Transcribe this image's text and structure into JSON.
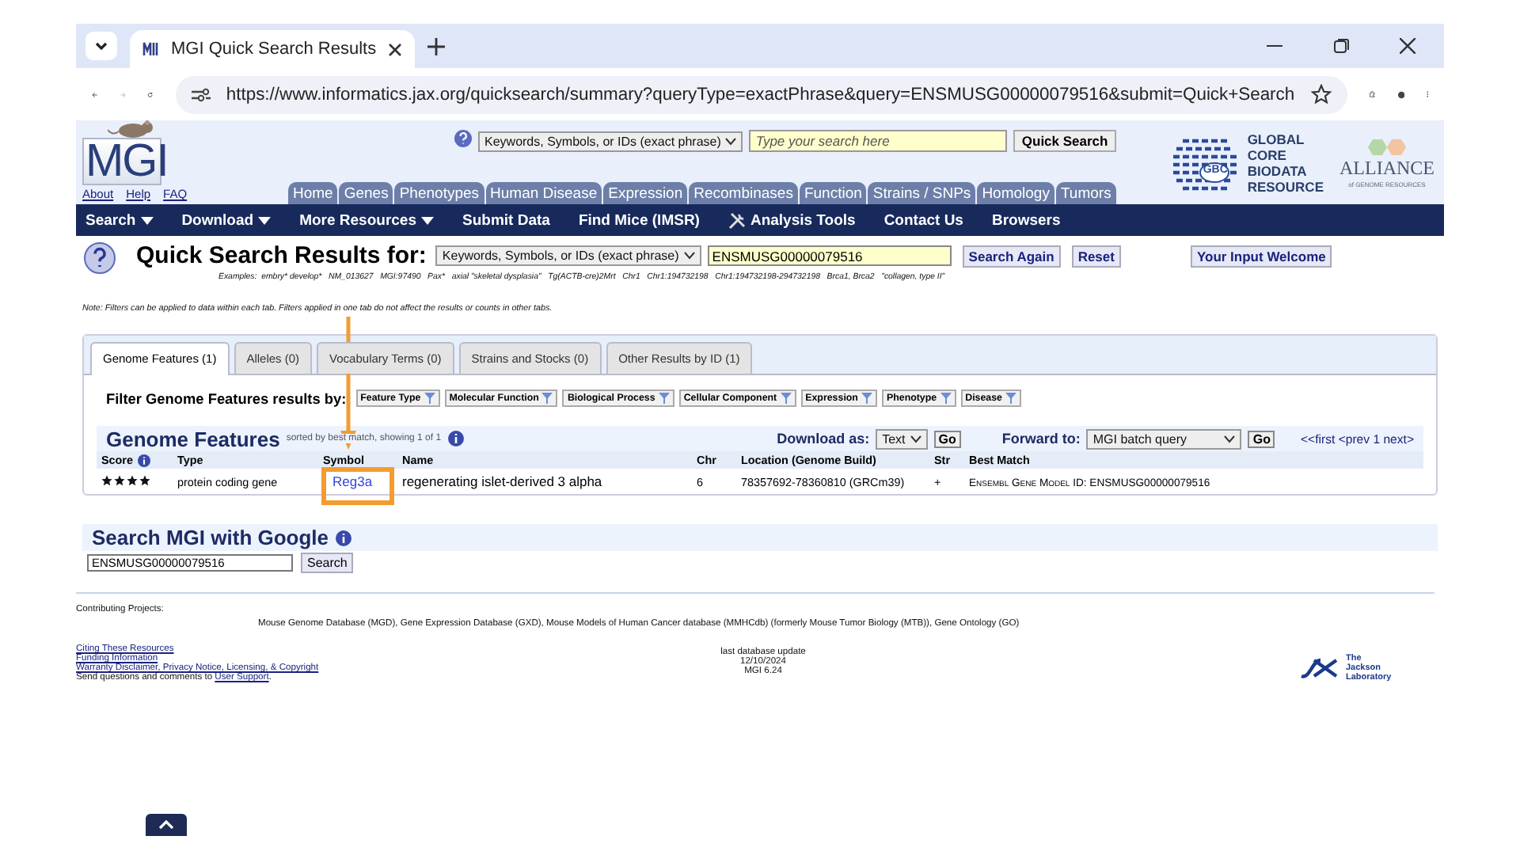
{
  "browser": {
    "tab_title": "MGI Quick Search Results",
    "url": "https://www.informatics.jax.org/quicksearch/summary?queryType=exactPhrase&query=ENSMUSG00000079516&submit=Quick+Search"
  },
  "header": {
    "search_type": "Keywords, Symbols, or IDs (exact phrase)",
    "search_placeholder": "Type your search here",
    "quick_search_button": "Quick Search",
    "logo": "MGI",
    "links": [
      "About",
      "Help",
      "FAQ"
    ],
    "nav_tabs": [
      "Home",
      "Genes",
      "Phenotypes",
      "Human Disease",
      "Expression",
      "Recombinases",
      "Function",
      "Strains / SNPs",
      "Homology",
      "Tumors"
    ],
    "gbc_badge": "GBC",
    "gbc_lines": [
      "GLOBAL",
      "CORE",
      "BIODATA",
      "RESOURCE"
    ],
    "alliance": "ALLIANCE",
    "alliance_sub": "of GENOME RESOURCES"
  },
  "menu": [
    {
      "label": "Search",
      "caret": true,
      "kind": "text"
    },
    {
      "label": "Download",
      "caret": true,
      "kind": "text"
    },
    {
      "label": "More Resources",
      "caret": true,
      "kind": "text"
    },
    {
      "label": "Submit Data",
      "caret": false,
      "kind": "text"
    },
    {
      "label": "Find Mice (IMSR)",
      "caret": false,
      "kind": "text"
    },
    {
      "label": "Analysis Tools",
      "caret": false,
      "kind": "tools"
    },
    {
      "label": "Contact Us",
      "caret": false,
      "kind": "text"
    },
    {
      "label": "Browsers",
      "caret": false,
      "kind": "text"
    }
  ],
  "quick_search": {
    "title": "Quick Search Results for:",
    "search_type": "Keywords, Symbols, or IDs (exact phrase)",
    "query": "ENSMUSG00000079516",
    "buttons": [
      "Search Again",
      "Reset"
    ],
    "feedback_button": "Your Input Welcome",
    "examples": "Examples:  embry* develop*   NM_013627   MGI:97490   Pax*   axial \"skeletal dysplasia\"   Tg(ACTB-cre)2Mrt   Chr1   Chr1:194732198   Chr1:194732198-294732198   Brca1, Brca2   \"collagen, type II\"",
    "note": "Note: Filters can be applied to data within each tab. Filters applied in one tab do not affect the results or counts in other tabs."
  },
  "result_tabs": [
    {
      "label": "Genome Features (1)",
      "selected": true
    },
    {
      "label": "Alleles (0)",
      "selected": false
    },
    {
      "label": "Vocabulary Terms (0)",
      "selected": false
    },
    {
      "label": "Strains and Stocks (0)",
      "selected": false
    },
    {
      "label": "Other Results by ID (1)",
      "selected": false
    }
  ],
  "filter": {
    "label": "Filter Genome Features results by:",
    "buttons": [
      "Feature Type",
      "Molecular Function",
      "Biological Process",
      "Cellular Component",
      "Expression",
      "Phenotype",
      "Disease"
    ]
  },
  "results": {
    "title": "Genome Features",
    "subtitle": "sorted by best match, showing 1 of 1",
    "download_label": "Download as:",
    "download_format": "Text",
    "download_go": "Go",
    "forward_label": "Forward to:",
    "forward_target": "MGI batch query",
    "forward_go": "Go",
    "pager": "<<first <prev 1 next>",
    "columns": [
      "Score",
      "Type",
      "Symbol",
      "Name",
      "Chr",
      "Location (Genome Build)",
      "Str",
      "Best Match"
    ],
    "rows": [
      {
        "stars": 4,
        "type": "protein coding gene",
        "symbol": "Reg3a",
        "name": "regenerating islet-derived 3 alpha",
        "chr": "6",
        "location": "78357692-78360810 (GRCm39)",
        "strand": "+",
        "best_match": "Ensembl Gene Model ID: ENSMUSG00000079516"
      }
    ]
  },
  "google": {
    "title": "Search MGI with Google",
    "query": "ENSMUSG00000079516",
    "button": "Search"
  },
  "footer": {
    "contributing_label": "Contributing Projects:",
    "projects": "Mouse Genome Database (MGD), Gene Expression Database (GXD), Mouse Models of Human Cancer database (MMHCdb) (formerly Mouse Tumor Biology (MTB)), Gene Ontology (GO)",
    "links": [
      "Citing These Resources",
      "Funding Information",
      "Warranty Disclaimer, Privacy Notice, Licensing, & Copyright"
    ],
    "contact_text": "Send questions and comments to",
    "contact_link": "User Support",
    "contact_end": ".",
    "update_lines": [
      "last database update",
      "12/10/2024",
      "MGI 6.24"
    ],
    "jax_logo": "The Jackson Laboratory"
  }
}
